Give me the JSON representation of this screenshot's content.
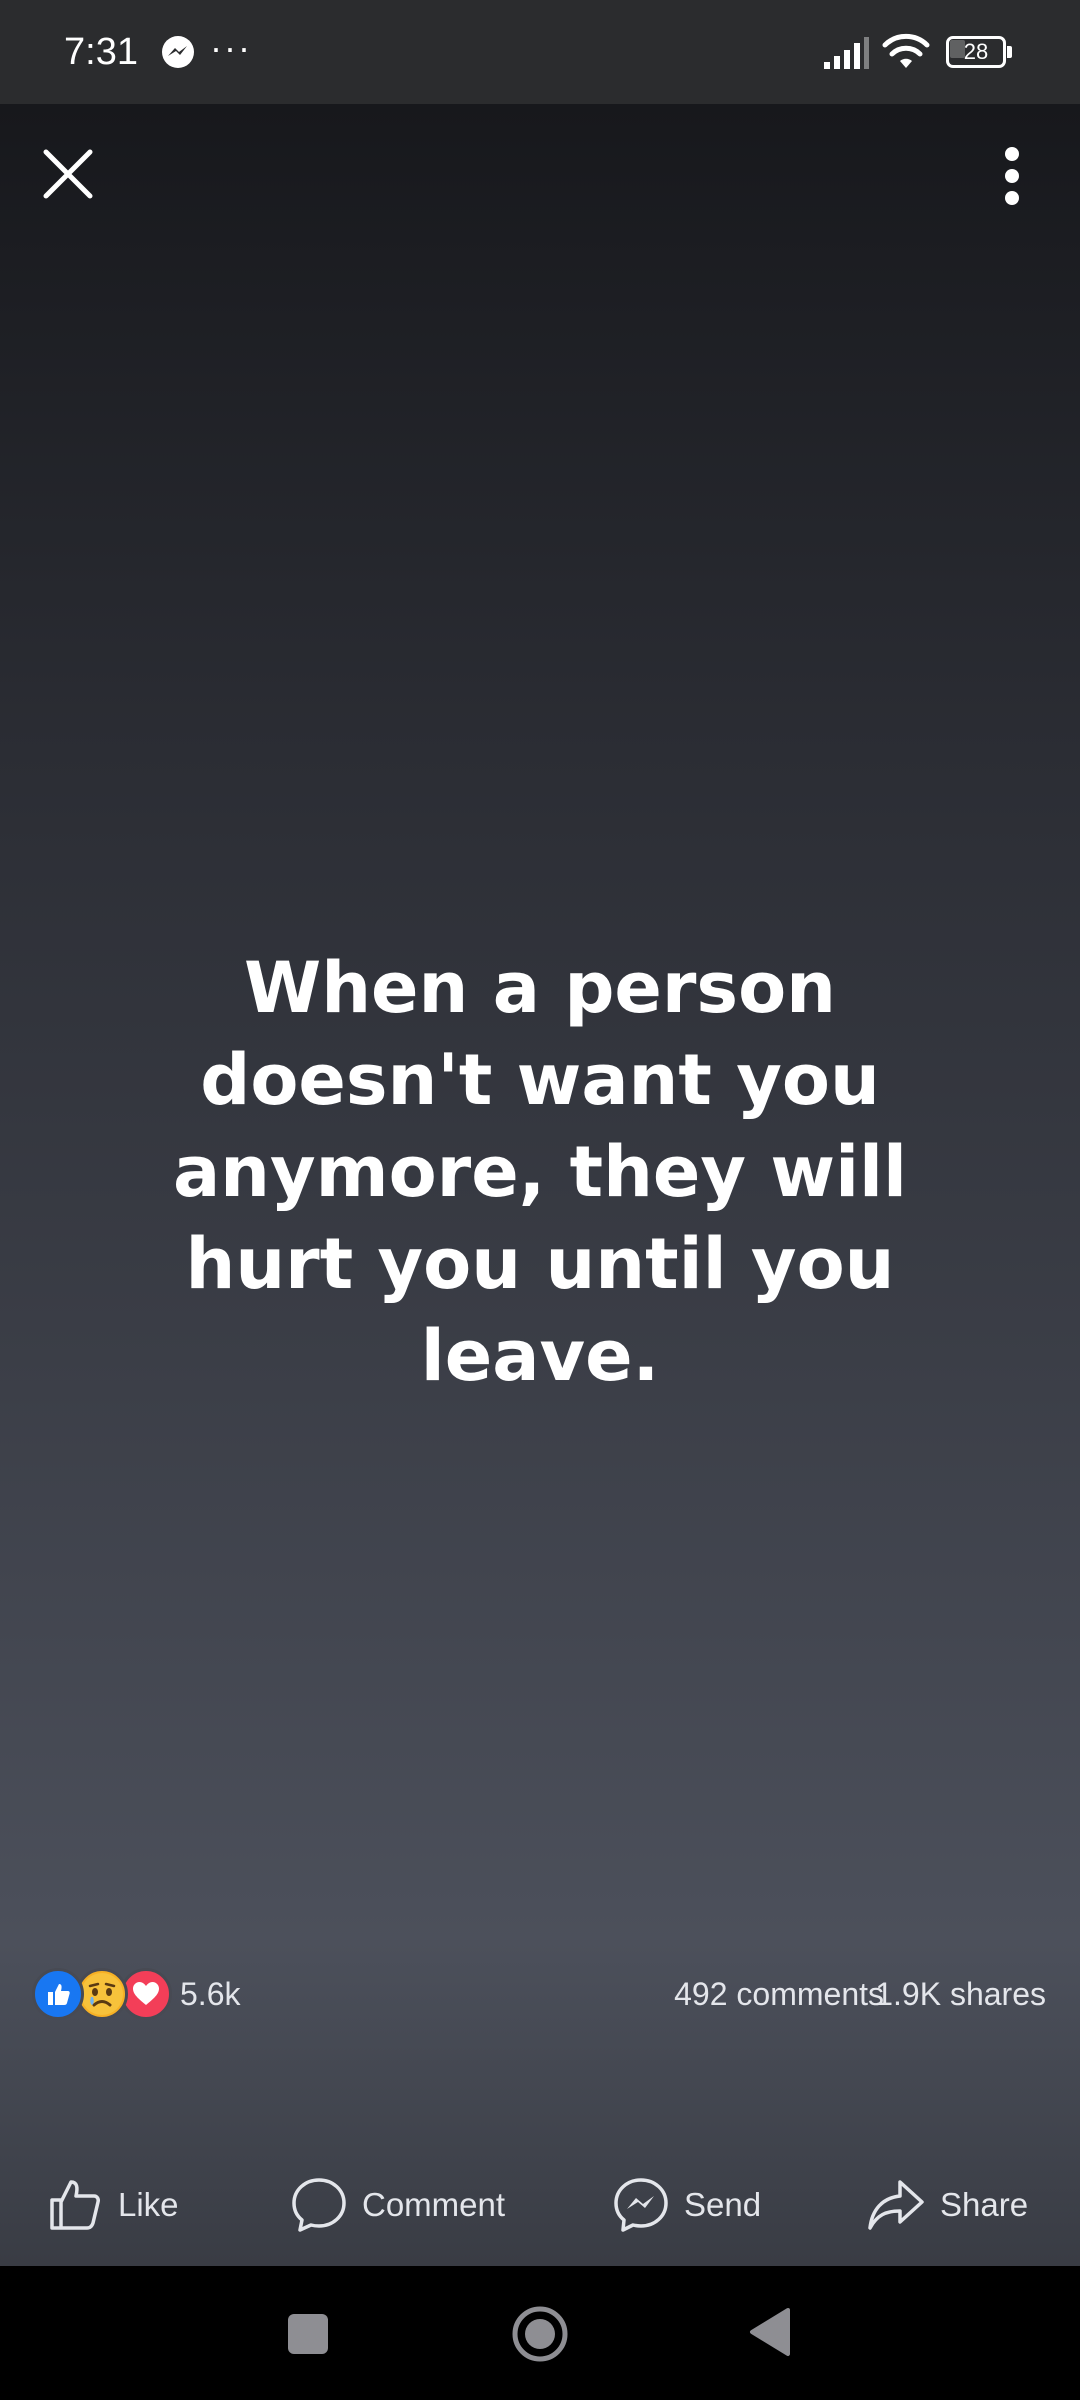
{
  "status_bar": {
    "time": "7:31",
    "overflow": "···",
    "battery": "28",
    "battery_level": 0.28,
    "icons": [
      "messenger-icon",
      "signal-icon",
      "wifi-icon",
      "battery-icon"
    ]
  },
  "viewer": {
    "icons": [
      "close-icon",
      "more-vertical-icon"
    ],
    "post_text": "When a person doesn't want you anymore, they will hurt you until you leave."
  },
  "engagement": {
    "reactions": [
      "like-reaction-icon",
      "sad-reaction-icon",
      "love-reaction-icon"
    ],
    "reaction_count": "5.6k",
    "comments": "492 comments",
    "shares": "1.9K shares"
  },
  "actions": {
    "like": "Like",
    "comment": "Comment",
    "send": "Send",
    "share": "Share"
  },
  "colors": {
    "like_blue": "#1877f2",
    "sad_yellow": "#f7b125",
    "love_red": "#f33e58",
    "text": "#e4e6eb"
  },
  "nav_bar": {
    "icons": [
      "recents-icon",
      "home-icon",
      "back-icon"
    ]
  }
}
